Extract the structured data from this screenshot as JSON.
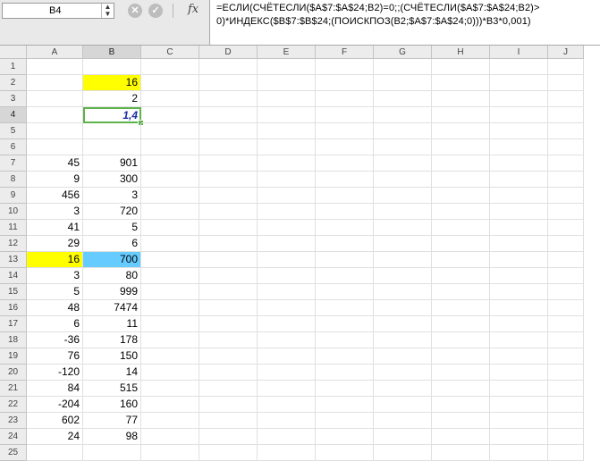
{
  "formula_bar": {
    "cell_ref": "B4",
    "fx_label": "fx",
    "cancel_glyph": "✕",
    "confirm_glyph": "✓",
    "formula_line1": "=ЕСЛИ(СЧЁТЕСЛИ($A$7:$A$24;B2)=0;;(СЧЁТЕСЛИ($A$7:$A$24;B2)>",
    "formula_line2": "0)*ИНДЕКС($B$7:$B$24;(ПОИСКПОЗ(B2;$A$7:$A$24;0)))*B3*0,001)"
  },
  "sheet": {
    "columns": [
      "A",
      "B",
      "C",
      "D",
      "E",
      "F",
      "G",
      "H",
      "I",
      "J"
    ],
    "selected_column": "B",
    "selected_row": 4,
    "row_numbers": [
      1,
      2,
      3,
      4,
      5,
      6,
      7,
      8,
      9,
      10,
      11,
      12,
      13,
      14,
      15,
      16,
      17,
      18,
      19,
      20,
      21,
      22,
      23,
      24,
      25
    ],
    "cells": {
      "B2": "16",
      "B3": "2",
      "B4": "1,4",
      "A7": "45",
      "B7": "901",
      "A8": "9",
      "B8": "300",
      "A9": "456",
      "B9": "3",
      "A10": "3",
      "B10": "720",
      "A11": "41",
      "B11": "5",
      "A12": "29",
      "B12": "6",
      "A13": "16",
      "B13": "700",
      "A14": "3",
      "B14": "80",
      "A15": "5",
      "B15": "999",
      "A16": "48",
      "B16": "7474",
      "A17": "6",
      "B17": "11",
      "A18": "-36",
      "B18": "178",
      "A19": "76",
      "B19": "150",
      "A20": "-120",
      "B20": "14",
      "A21": "84",
      "B21": "515",
      "A22": "-204",
      "B22": "160",
      "A23": "602",
      "B23": "77",
      "A24": "24",
      "B24": "98"
    },
    "highlight_colors": {
      "yellow": "#ffff00",
      "blue": "#66ccff",
      "active_border": "#5eb24a"
    }
  }
}
